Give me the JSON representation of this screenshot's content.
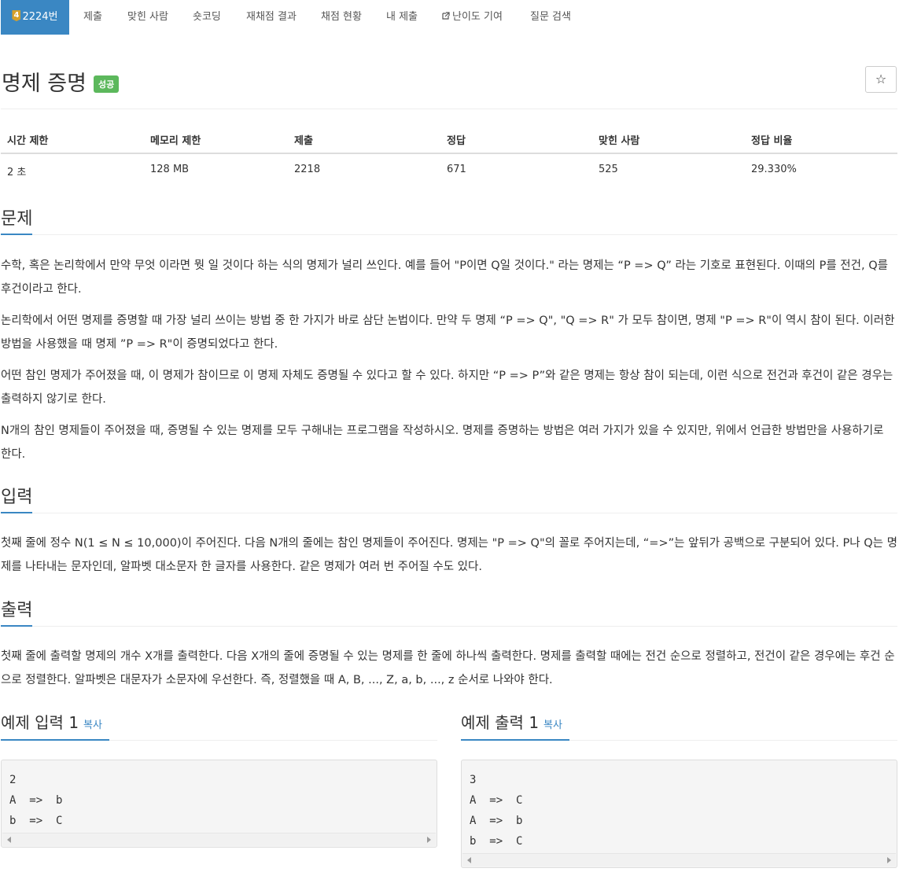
{
  "nav": {
    "level": "4",
    "problem_tab": "2224번",
    "items": [
      "제출",
      "맞힌 사람",
      "숏코딩",
      "재채점 결과",
      "채점 현황",
      "내 제출",
      "난이도 기여",
      "질문 검색"
    ]
  },
  "title": "명제 증명",
  "status_badge": "성공",
  "star_icon": "☆",
  "stats": {
    "headers": [
      "시간 제한",
      "메모리 제한",
      "제출",
      "정답",
      "맞힌 사람",
      "정답 비율"
    ],
    "values": [
      "2 초",
      "128 MB",
      "2218",
      "671",
      "525",
      "29.330%"
    ]
  },
  "sections": {
    "problem": {
      "title": "문제",
      "paragraphs": [
        "수학, 혹은 논리학에서 만약 무엇 이라면 뭣 일 것이다 하는 식의 명제가 널리 쓰인다. 예를 들어 \"P이면 Q일 것이다.\" 라는 명제는 “P => Q” 라는 기호로 표현된다. 이때의 P를 전건, Q를 후건이라고 한다.",
        "논리학에서 어떤 명제를 증명할 때 가장 널리 쓰이는 방법 중 한 가지가 바로 삼단 논법이다. 만약 두 명제 “P => Q\", \"Q => R\" 가 모두 참이면, 명제 \"P => R\"이 역시 참이 된다. 이러한 방법을 사용했을 때 명제 ”P => R\"이 증명되었다고 한다.",
        "어떤 참인 명제가 주어졌을 때, 이 명제가 참이므로 이 명제 자체도 증명될 수 있다고 할 수 있다. 하지만 “P => P”와 같은 명제는 항상 참이 되는데, 이런 식으로 전건과 후건이 같은 경우는 출력하지 않기로 한다.",
        "N개의 참인 명제들이 주어졌을 때, 증명될 수 있는 명제를 모두 구해내는 프로그램을 작성하시오. 명제를 증명하는 방법은 여러 가지가 있을 수 있지만, 위에서 언급한 방법만을 사용하기로 한다."
      ]
    },
    "input": {
      "title": "입력",
      "paragraphs": [
        "첫째 줄에 정수 N(1 ≤ N ≤ 10,000)이 주어진다. 다음 N개의 줄에는 참인 명제들이 주어진다. 명제는 \"P => Q\"의 꼴로 주어지는데, “=>”는 앞뒤가 공백으로 구분되어 있다. P나 Q는 명제를 나타내는 문자인데, 알파벳 대소문자 한 글자를 사용한다. 같은 명제가 여러 번 주어질 수도 있다."
      ]
    },
    "output": {
      "title": "출력",
      "paragraphs": [
        "첫째 줄에 출력할 명제의 개수 X개를 출력한다. 다음 X개의 줄에 증명될 수 있는 명제를 한 줄에 하나씩 출력한다. 명제를 출력할 때에는 전건 순으로 정렬하고, 전건이 같은 경우에는 후건 순으로 정렬한다. 알파벳은 대문자가 소문자에 우선한다. 즉, 정렬했을 때 A, B, ..., Z, a, b, ..., z 순서로 나와야 한다."
      ]
    }
  },
  "samples": {
    "copy_label": "복사",
    "input_title": "예제 입력 1",
    "input_lines": "2\nA  =>  b\nb  =>  C",
    "output_title": "예제 출력 1",
    "output_lines": "3\nA  =>  C\nA  =>  b\nb  =>  C"
  },
  "colors": {
    "primary": "#3a87c3",
    "success": "#5cb85c",
    "level_badge": "#d7a02a"
  }
}
